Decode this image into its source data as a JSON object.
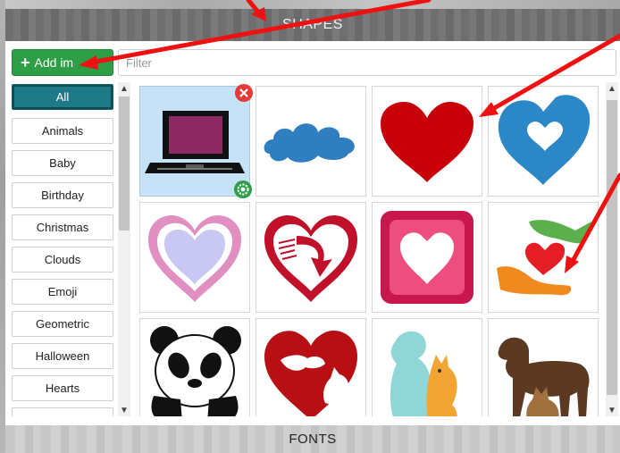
{
  "panel": {
    "title": "SHAPES",
    "add_button_label": "Add im",
    "filter_placeholder": "Filter",
    "footer_title": "FONTS"
  },
  "categories": [
    {
      "label": "All",
      "active": true
    },
    {
      "label": "Animals"
    },
    {
      "label": "Baby"
    },
    {
      "label": "Birthday"
    },
    {
      "label": "Christmas"
    },
    {
      "label": "Clouds"
    },
    {
      "label": "Emoji"
    },
    {
      "label": "Geometric"
    },
    {
      "label": "Halloween"
    },
    {
      "label": "Hearts"
    }
  ],
  "shapes": [
    {
      "icon": "laptop-icon",
      "selected": true
    },
    {
      "icon": "cloud-icon"
    },
    {
      "icon": "red-heart-icon"
    },
    {
      "icon": "blue-heart-icon"
    },
    {
      "icon": "pink-heart-outline-icon"
    },
    {
      "icon": "heart-arrow-icon"
    },
    {
      "icon": "heart-square-icon"
    },
    {
      "icon": "hands-heart-icon"
    },
    {
      "icon": "panda-icon"
    },
    {
      "icon": "heart-cat-dog-icon"
    },
    {
      "icon": "dog-cat-icon"
    },
    {
      "icon": "dog-cat-brown-icon"
    }
  ],
  "colors": {
    "accent_green": "#2e9e46",
    "active_category": "#1d7a86",
    "annotation_red": "#ee1111"
  }
}
